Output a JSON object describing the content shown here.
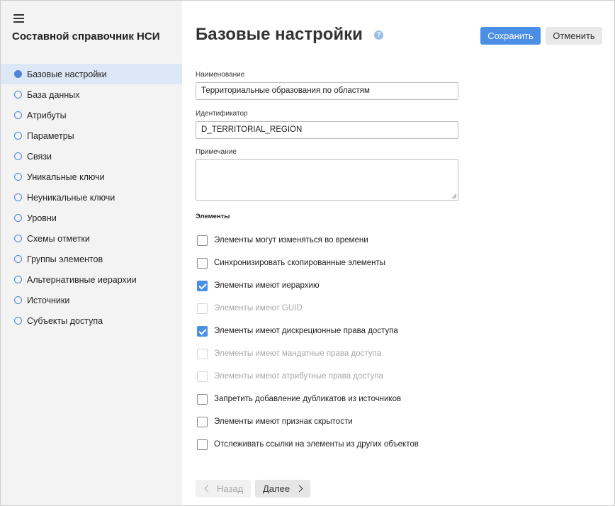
{
  "sidebar": {
    "title": "Составной справочник НСИ",
    "items": [
      {
        "label": "Базовые настройки",
        "active": true
      },
      {
        "label": "База данных"
      },
      {
        "label": "Атрибуты"
      },
      {
        "label": "Параметры"
      },
      {
        "label": "Связи"
      },
      {
        "label": "Уникальные ключи"
      },
      {
        "label": "Неуникальные ключи"
      },
      {
        "label": "Уровни"
      },
      {
        "label": "Схемы отметки"
      },
      {
        "label": "Группы элементов"
      },
      {
        "label": "Альтернативные иерархии"
      },
      {
        "label": "Источники"
      },
      {
        "label": "Субъекты доступа"
      }
    ]
  },
  "header": {
    "title": "Базовые настройки",
    "help_icon": "?",
    "save_label": "Сохранить",
    "cancel_label": "Отменить"
  },
  "form": {
    "name_label": "Наименование",
    "name_value": "Территориальные образования по областям",
    "id_label": "Идентификатор",
    "id_value": "D_TERRITORIAL_REGION",
    "note_label": "Примечание",
    "note_value": ""
  },
  "elements": {
    "title": "Элементы",
    "options": [
      {
        "label": "Элементы могут изменяться во времени",
        "checked": false,
        "disabled": false
      },
      {
        "label": "Синхронизировать скопированные элементы",
        "checked": false,
        "disabled": false
      },
      {
        "label": "Элементы имеют иерархию",
        "checked": true,
        "disabled": false
      },
      {
        "label": "Элементы имеют GUID",
        "checked": false,
        "disabled": true
      },
      {
        "label": "Элементы имеют дискреционные права доступа",
        "checked": true,
        "disabled": false
      },
      {
        "label": "Элементы имеют мандатные права доступа",
        "checked": false,
        "disabled": true
      },
      {
        "label": "Элементы имеют атрибутные права доступа",
        "checked": false,
        "disabled": true
      },
      {
        "label": "Запретить добавление дубликатов из источников",
        "checked": false,
        "disabled": false
      },
      {
        "label": "Элементы имеют признак скрытости",
        "checked": false,
        "disabled": false
      },
      {
        "label": "Отслеживать ссылки на элементы из других объектов",
        "checked": false,
        "disabled": false
      }
    ]
  },
  "footer": {
    "back_label": "Назад",
    "next_label": "Далее"
  },
  "colors": {
    "accent": "#4a8ee6",
    "active_nav_bg": "#dde8f7",
    "sidebar_bg": "#f3f3f3"
  }
}
